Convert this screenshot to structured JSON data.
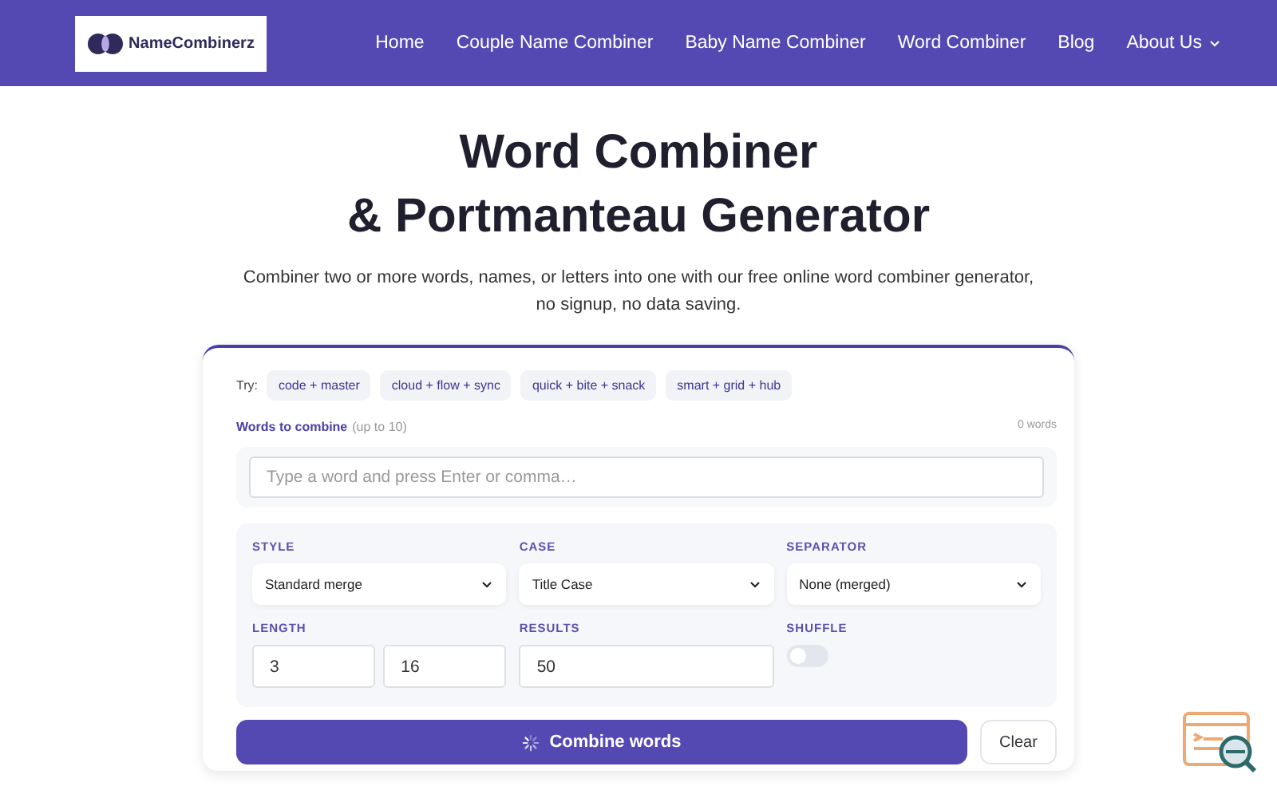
{
  "header": {
    "logo": "NameCombinerz",
    "nav": [
      {
        "label": "Home",
        "dropdown": false
      },
      {
        "label": "Couple Name Combiner",
        "dropdown": false
      },
      {
        "label": "Baby Name Combiner",
        "dropdown": false
      },
      {
        "label": "Word Combiner",
        "dropdown": false
      },
      {
        "label": "Blog",
        "dropdown": false
      },
      {
        "label": "About Us",
        "dropdown": true
      }
    ]
  },
  "hero": {
    "title_lines": [
      "Word Combiner",
      "& Portmanteau Generator"
    ],
    "subtitle": "Combiner two or more words, names, or letters into one with our free online word combiner generator, no signup, no data saving."
  },
  "tool": {
    "try_label": "Try:",
    "examples": [
      "code + master",
      "cloud + flow + sync",
      "quick + bite + snack",
      "smart + grid + hub"
    ],
    "words_label": "Words to combine",
    "words_hint": "(up to 10)",
    "word_count": "0 words",
    "input_placeholder": "Type a word and press Enter or comma…",
    "selects": [
      {
        "label": "STYLE",
        "value": "Standard merge"
      },
      {
        "label": "CASE",
        "value": "Title Case"
      },
      {
        "label": "SEPARATOR",
        "value": "None (merged)"
      }
    ],
    "length": {
      "label": "LENGTH",
      "min": "3",
      "max": "16"
    },
    "results": {
      "label": "RESULTS",
      "value": "50"
    },
    "shuffle": {
      "label": "SHUFFLE",
      "on": false
    },
    "combine_button": "Combine words",
    "clear_button": "Clear"
  }
}
